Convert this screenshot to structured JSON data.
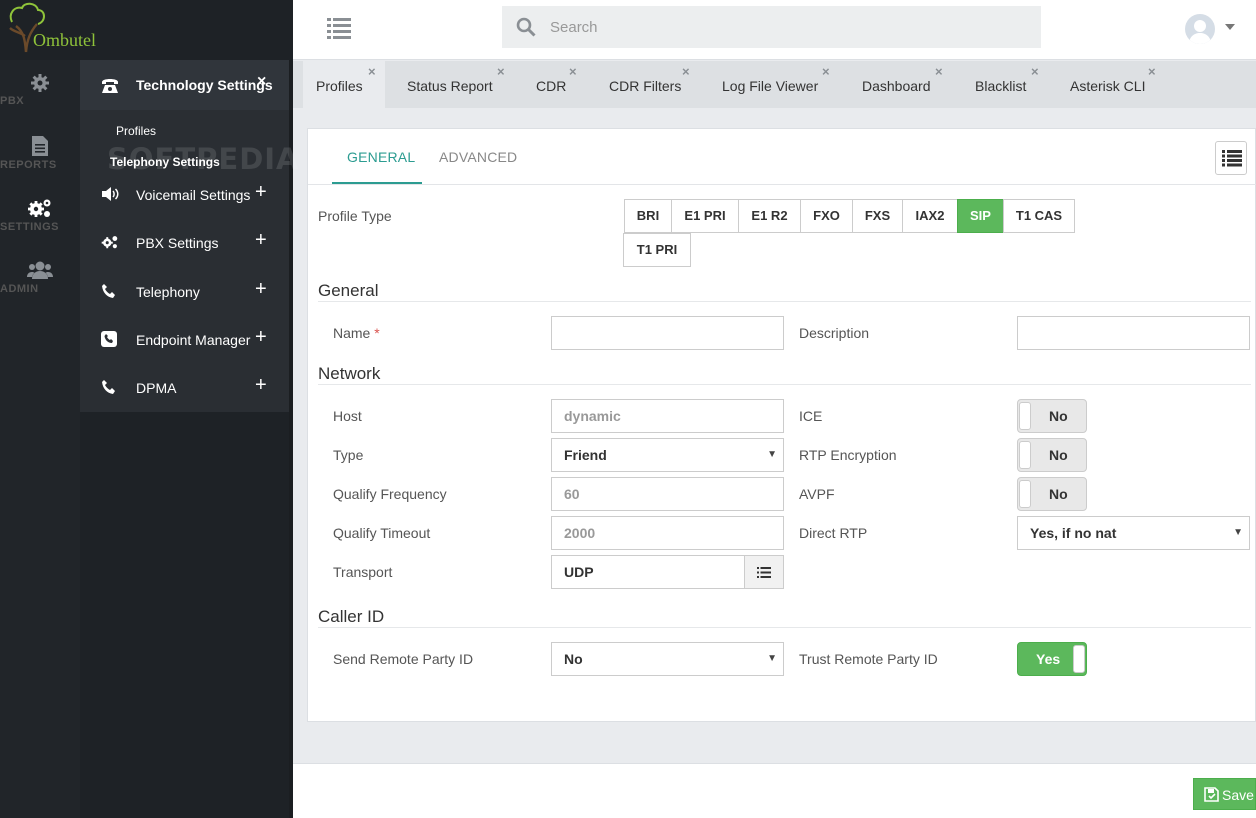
{
  "app": {
    "name": "Ombutel"
  },
  "rail": [
    {
      "label": "PBX",
      "icon": "gear-icon"
    },
    {
      "label": "REPORTS",
      "icon": "document-icon"
    },
    {
      "label": "SETTINGS",
      "icon": "gears-icon",
      "active": true
    },
    {
      "label": "ADMIN",
      "icon": "users-icon"
    }
  ],
  "menu": {
    "header": {
      "label": "Technology Settings",
      "close": "×",
      "icon": "phone-icon"
    },
    "subitems": [
      "Profiles",
      "Telephony Settings"
    ],
    "watermark": "SOFTPEDIA",
    "items": [
      {
        "label": "Voicemail Settings",
        "icon": "speaker-icon",
        "expand": "+"
      },
      {
        "label": "PBX Settings",
        "icon": "gears-icon",
        "expand": "+"
      },
      {
        "label": "Telephony",
        "icon": "phone-icon",
        "expand": "+"
      },
      {
        "label": "Endpoint Manager",
        "icon": "phone-square-icon",
        "expand": "+"
      },
      {
        "label": "DPMA",
        "icon": "phone-icon",
        "expand": "+"
      }
    ]
  },
  "topbar": {
    "search_placeholder": "Search"
  },
  "tabs": [
    {
      "label": "Profiles",
      "close": "×",
      "active": true
    },
    {
      "label": "Status Report",
      "close": "×"
    },
    {
      "label": "CDR",
      "close": "×"
    },
    {
      "label": "CDR Filters",
      "close": "×"
    },
    {
      "label": "Log File Viewer",
      "close": "×"
    },
    {
      "label": "Dashboard",
      "close": "×"
    },
    {
      "label": "Blacklist",
      "close": "×"
    },
    {
      "label": "Asterisk CLI",
      "close": "×"
    }
  ],
  "form": {
    "subtabs": [
      "GENERAL",
      "ADVANCED"
    ],
    "profile_type_label": "Profile Type",
    "profile_types": [
      "BRI",
      "E1 PRI",
      "E1 R2",
      "FXO",
      "FXS",
      "IAX2",
      "SIP",
      "T1 CAS",
      "T1 PRI"
    ],
    "profile_type_selected": "SIP",
    "sections": {
      "general": "General",
      "network": "Network",
      "caller_id": "Caller ID"
    },
    "general": {
      "name_label": "Name",
      "required_mark": "*",
      "name_value": "",
      "description_label": "Description",
      "description_value": ""
    },
    "network": {
      "host_label": "Host",
      "host_placeholder": "dynamic",
      "type_label": "Type",
      "type_value": "Friend",
      "qualify_frequency_label": "Qualify Frequency",
      "qualify_frequency_value": "60",
      "qualify_timeout_label": "Qualify Timeout",
      "qualify_timeout_value": "2000",
      "transport_label": "Transport",
      "transport_value": "UDP",
      "ice_label": "ICE",
      "ice_value": "No",
      "rtp_encryption_label": "RTP Encryption",
      "rtp_encryption_value": "No",
      "avpf_label": "AVPF",
      "avpf_value": "No",
      "direct_rtp_label": "Direct RTP",
      "direct_rtp_value": "Yes, if no nat"
    },
    "caller_id": {
      "send_rpid_label": "Send Remote Party ID",
      "send_rpid_value": "No",
      "trust_rpid_label": "Trust Remote Party ID",
      "trust_rpid_value": "Yes"
    }
  },
  "footer": {
    "save_label": "Save"
  },
  "colors": {
    "accent": "#2c9c91",
    "success": "#5cb85c",
    "sidebar": "#212529"
  }
}
